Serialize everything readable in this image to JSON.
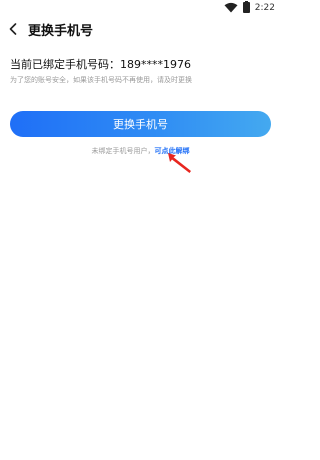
{
  "status": {
    "time": "2:22"
  },
  "header": {
    "title": "更换手机号"
  },
  "main": {
    "current_label": "当前已绑定手机号码：",
    "phone_masked": "189****1976",
    "hint": "为了您的账号安全，如果该手机号码不再使用，请及时更换",
    "change_button_label": "更换手机号",
    "unbind_prefix": "未绑定手机号用户，",
    "unbind_link": "可点此解绑"
  },
  "colors": {
    "accent": "#1f6ff7",
    "arrow": "#e8261f",
    "hint_text": "#9a9a9a"
  },
  "icons": {
    "back": "chevron-left-icon",
    "wifi": "wifi-icon",
    "battery": "battery-icon",
    "annotation": "red-arrow-icon"
  }
}
